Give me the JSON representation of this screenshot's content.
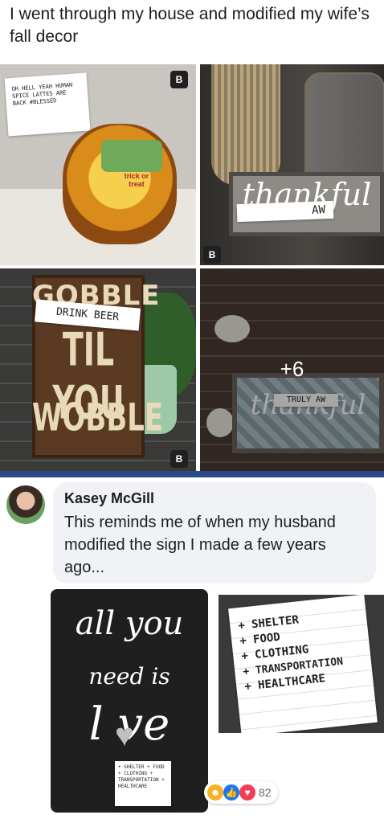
{
  "post": {
    "text": "I went through my house and modified my wife’s fall decor"
  },
  "photos": {
    "p1_note": "OH HELL YEAH HUMAN SPICE LATTES ARE BACK #BLESSED",
    "p1_hat": "trick or treat",
    "p2_sign": "thankful",
    "p2_label": "AW",
    "p3_sign_line1": "GOBBLE",
    "p3_sign_line2": "TIL YOU",
    "p3_sign_line3": "WOBBLE",
    "p3_label": "DRINK BEER",
    "p4_sign": "thankful",
    "p4_label": "TRULY AW",
    "more_count": "+6",
    "watermark": "B"
  },
  "comment": {
    "author": "Kasey McGill",
    "text": "This reminds me of when my husband modified the sign I made a few years ago...",
    "image_a_line1": "all you",
    "image_a_line2": "need is",
    "image_a_line3": "l ve",
    "image_a_note": "+ SHELTER + FOOD + CLOTHING + TRANSPORTATION + HEALTHCARE",
    "image_b_items": [
      "+ SHELTER",
      "+ FOOD",
      "+ CLOTHING",
      "+ TRANSPORTATION",
      "+ HEALTHCARE"
    ],
    "reactions": {
      "count": "82",
      "icons": [
        "haha-icon",
        "like-icon",
        "love-icon"
      ]
    }
  },
  "colors": {
    "accent_blue": "#2a4a86",
    "comment_bg": "#f0f2f5"
  }
}
